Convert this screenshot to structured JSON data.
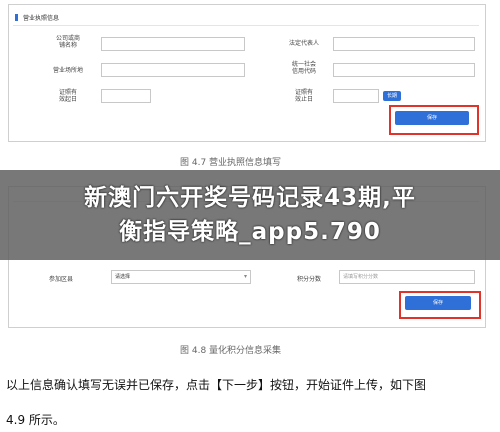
{
  "figure1": {
    "section_title": "营业执照信息",
    "label_company_name": "公司或商\n铺名称",
    "label_business_address": "营业场所地",
    "label_valid_from": "证照有\n效起日",
    "label_legal_rep": "法定代表人",
    "label_credit_code": "统一社会\n信用代码",
    "label_valid_to": "证照有\n效止日",
    "long_term_button": "长期",
    "save_button": "保存",
    "caption": "图 4.7  营业执照信息填写"
  },
  "figure2": {
    "label_area": "参加区县",
    "area_select_value": "请选择",
    "label_score": "积分分数",
    "score_placeholder": "请填写积分分数",
    "save_button": "保存",
    "caption": "图 4.8  量化积分信息采集"
  },
  "overlay": {
    "line1": "新澳门六开奖号码记录43期,平",
    "line2": "衡指导策略_app5.790"
  },
  "paragraph": {
    "line1": "以上信息确认填写无误并已保存，点击【下一步】按钮，开始证件上传，如下图",
    "line2": "4.9 所示。"
  }
}
